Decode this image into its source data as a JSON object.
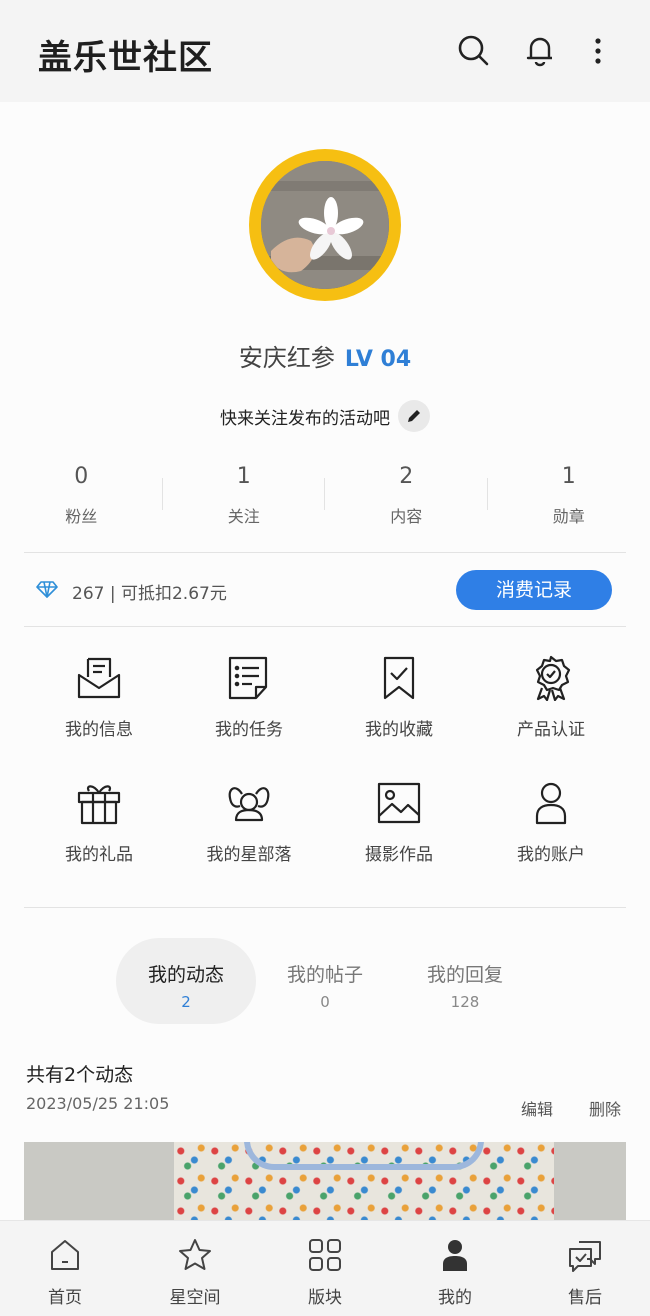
{
  "header": {
    "title": "盖乐世社区",
    "icons": [
      "search-icon",
      "bell-icon",
      "more-vertical-icon"
    ]
  },
  "profile": {
    "name": "安庆红参",
    "level": "LV 04",
    "bio": "快来关注发布的活动吧",
    "avatar_ring_color": "#f6bf12",
    "level_color": "#2f7fd6"
  },
  "stats": [
    {
      "value": "0",
      "label": "粉丝"
    },
    {
      "value": "1",
      "label": "关注"
    },
    {
      "value": "2",
      "label": "内容"
    },
    {
      "value": "1",
      "label": "勋章"
    }
  ],
  "points": {
    "text": "267 | 可抵扣2.67元",
    "button": "消费记录",
    "icon": "diamond-icon",
    "button_color": "#2f7fe6"
  },
  "menu": [
    {
      "label": "我的信息",
      "icon": "message-envelope-icon"
    },
    {
      "label": "我的任务",
      "icon": "task-list-icon"
    },
    {
      "label": "我的收藏",
      "icon": "bookmark-check-icon"
    },
    {
      "label": "产品认证",
      "icon": "certified-badge-icon"
    },
    {
      "label": "我的礼品",
      "icon": "gift-icon"
    },
    {
      "label": "我的星部落",
      "icon": "group-people-icon"
    },
    {
      "label": "摄影作品",
      "icon": "image-icon"
    },
    {
      "label": "我的账户",
      "icon": "account-icon"
    }
  ],
  "tabs": [
    {
      "label": "我的动态",
      "count": "2",
      "active": true
    },
    {
      "label": "我的帖子",
      "count": "0",
      "active": false
    },
    {
      "label": "我的回复",
      "count": "128",
      "active": false
    }
  ],
  "posts": {
    "summary": "共有2个动态",
    "date": "2023/05/25 21:05",
    "edit": "编辑",
    "delete": "删除"
  },
  "bottom_nav": [
    {
      "label": "首页",
      "icon": "home-icon"
    },
    {
      "label": "星空间",
      "icon": "star-icon"
    },
    {
      "label": "版块",
      "icon": "grid-icon"
    },
    {
      "label": "我的",
      "icon": "person-icon",
      "active": true
    },
    {
      "label": "售后",
      "icon": "chat-check-icon"
    }
  ]
}
